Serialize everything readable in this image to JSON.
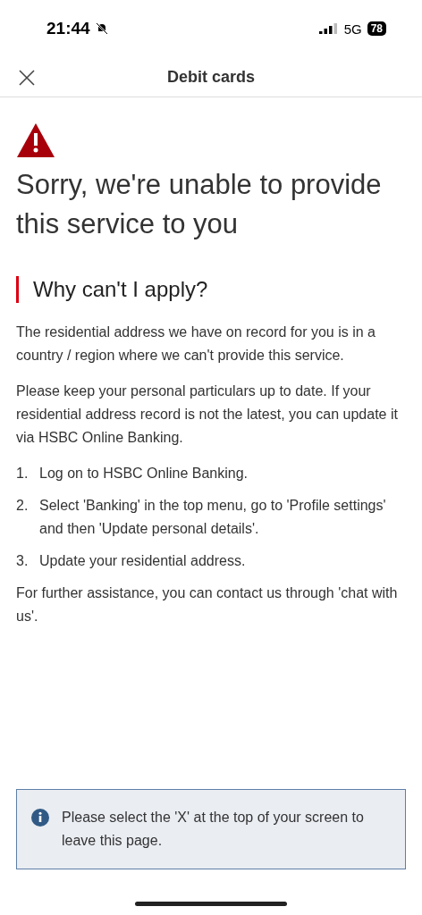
{
  "status_bar": {
    "time": "21:44",
    "network": "5G",
    "battery": "78"
  },
  "header": {
    "title": "Debit cards"
  },
  "title": "Sorry, we're unable to provide this service to you",
  "section_heading": "Why can't I apply?",
  "paragraphs": [
    "The residential address we have on record for you is in a country / region where we can't provide this service.",
    "Please keep your personal particulars up to date. If your residential address record is not the latest, you can update it via HSBC Online Banking."
  ],
  "steps": [
    {
      "number": "1.",
      "text": "Log on to HSBC Online Banking."
    },
    {
      "number": "2.",
      "text": "Select 'Banking' in the top menu, go to 'Profile settings' and then 'Update personal details'."
    },
    {
      "number": "3.",
      "text": "Update your residential address."
    }
  ],
  "closing": "For further assistance, you can contact us through 'chat with us'.",
  "notice": "Please select the 'X' at the top of your screen to leave this page."
}
